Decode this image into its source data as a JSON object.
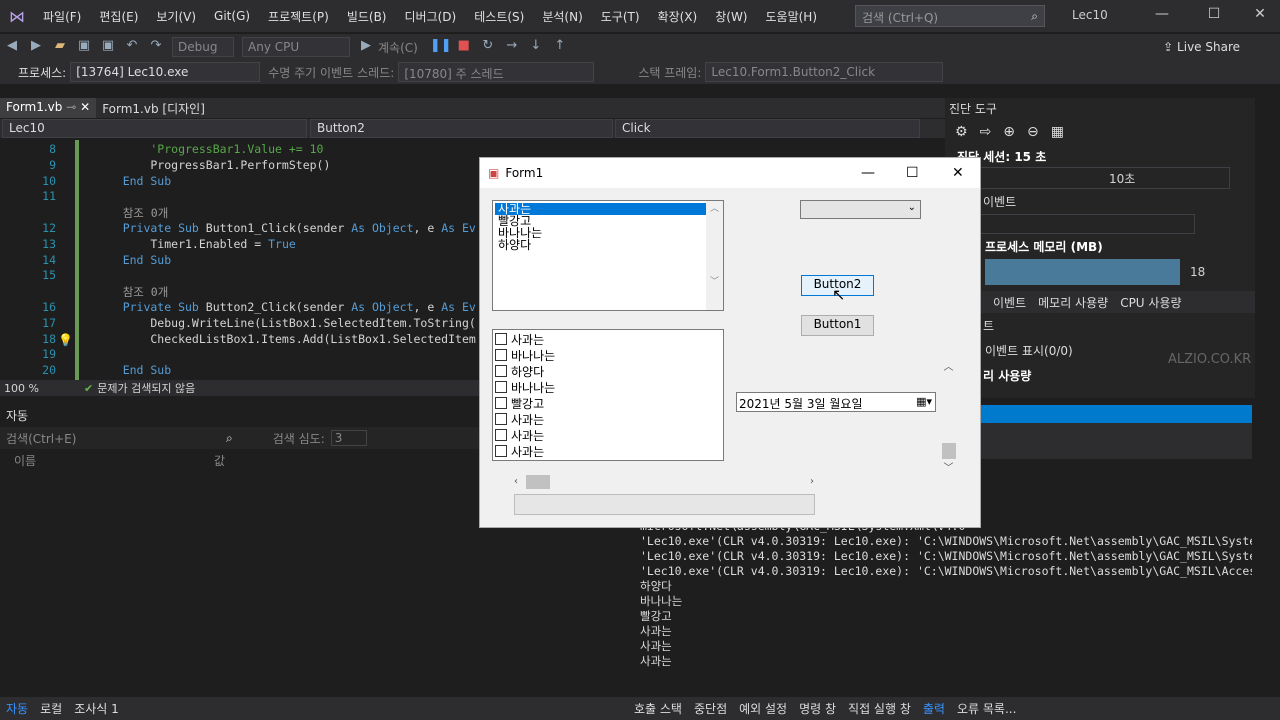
{
  "menu": [
    "파일(F)",
    "편집(E)",
    "보기(V)",
    "Git(G)",
    "프로젝트(P)",
    "빌드(B)",
    "디버그(D)",
    "테스트(S)",
    "분석(N)",
    "도구(T)",
    "확장(X)",
    "창(W)",
    "도움말(H)"
  ],
  "search_placeholder": "검색 (Ctrl+Q)",
  "project_title": "Lec10",
  "toolbar": {
    "config": "Debug",
    "platform": "Any CPU",
    "continue": "계속(C)",
    "live_share": "Live Share"
  },
  "toolbar2": {
    "process_label": "프로세스:",
    "process": "[13764] Lec10.exe",
    "lifecycle": "수명 주기 이벤트",
    "thread_label": "스레드:",
    "thread": "[10780] 주 스레드",
    "stack_label": "스택 프레임:",
    "stack": "Lec10.Form1.Button2_Click"
  },
  "tabs": [
    {
      "label": "Form1.vb"
    },
    {
      "label": "Form1.vb [디자인]"
    }
  ],
  "nav": {
    "project": "Lec10",
    "member": "Button2",
    "event": "Click"
  },
  "code_lines": [
    {
      "n": "8",
      "parts": [
        {
          "t": "        'ProgressBar1.Value += 10",
          "c": "cm"
        }
      ]
    },
    {
      "n": "9",
      "parts": [
        {
          "t": "        ProgressBar1.PerformStep()",
          "c": ""
        }
      ]
    },
    {
      "n": "10",
      "parts": [
        {
          "t": "    End Sub",
          "c": "kw"
        }
      ]
    },
    {
      "n": "11",
      "parts": [
        {
          "t": "",
          "c": ""
        }
      ]
    },
    {
      "n": "",
      "parts": [
        {
          "t": "    참조 0개",
          "c": "gr"
        }
      ]
    },
    {
      "n": "12",
      "parts": [
        {
          "t": "    Private Sub ",
          "c": "kw"
        },
        {
          "t": "Button1_Click(sender ",
          "c": ""
        },
        {
          "t": "As Object",
          "c": "kw"
        },
        {
          "t": ", e ",
          "c": ""
        },
        {
          "t": "As Ev",
          "c": "kw"
        }
      ]
    },
    {
      "n": "13",
      "parts": [
        {
          "t": "        Timer1.Enabled = ",
          "c": ""
        },
        {
          "t": "True",
          "c": "kw"
        }
      ]
    },
    {
      "n": "14",
      "parts": [
        {
          "t": "    End Sub",
          "c": "kw"
        }
      ]
    },
    {
      "n": "15",
      "parts": [
        {
          "t": "",
          "c": ""
        }
      ]
    },
    {
      "n": "",
      "parts": [
        {
          "t": "    참조 0개",
          "c": "gr"
        }
      ]
    },
    {
      "n": "16",
      "parts": [
        {
          "t": "    Private Sub ",
          "c": "kw"
        },
        {
          "t": "Button2_Click(sender ",
          "c": ""
        },
        {
          "t": "As Object",
          "c": "kw"
        },
        {
          "t": ", e ",
          "c": ""
        },
        {
          "t": "As Ev",
          "c": "kw"
        }
      ]
    },
    {
      "n": "17",
      "parts": [
        {
          "t": "        Debug.WriteLine(ListBox1.SelectedItem.ToString(",
          "c": ""
        }
      ]
    },
    {
      "n": "18",
      "parts": [
        {
          "t": "        CheckedListBox1.Items.Add(ListBox1.SelectedItem",
          "c": ""
        }
      ]
    },
    {
      "n": "19",
      "parts": [
        {
          "t": "",
          "c": ""
        }
      ]
    },
    {
      "n": "20",
      "parts": [
        {
          "t": "    End Sub",
          "c": "kw"
        }
      ]
    }
  ],
  "editor_status": {
    "zoom": "100 %",
    "issues": "문제가 검색되지 않음"
  },
  "autos": {
    "title": "자동",
    "search": "검색(Ctrl+E)",
    "depth_label": "검색 심도:",
    "depth": "3",
    "col_name": "이름",
    "col_value": "값"
  },
  "bottom_tabs_left": [
    "자동",
    "로컬",
    "조사식 1"
  ],
  "bottom_tabs_right": [
    "호출 스택",
    "중단점",
    "예외 설정",
    "명령 창",
    "직접 실행 창",
    "출력",
    "오류 목록..."
  ],
  "diag": {
    "title": "진단 도구",
    "session": "진단 세션: 15 초",
    "tick": "10초",
    "events": "이벤트",
    "memory": "프로세스 메모리 (MB)",
    "mem_value": "18",
    "tabs": [
      "이벤트",
      "메모리 사용량",
      "CPU 사용량"
    ],
    "ev_header": "트",
    "show_events": "이벤트 표시(0/0)",
    "mem_usage": "리 사용량"
  },
  "output_lines": [
    "microsoft.Net\\assembly\\GAC_MSIL\\System\\v4.0_4.0",
    "microsoft.Net\\assembly\\GAC_MSIL\\System.Drawing\\",
    "microsoft.Net\\assembly\\GAC_MSIL\\System.Configur",
    "microsoft.Net\\assembly\\GAC_MSIL\\System.Core\\v4.",
    "microsoft.Net\\assembly\\GAC_MSIL\\System.Xml\\v4.0",
    "'Lec10.exe'(CLR v4.0.30319: Lec10.exe): 'C:\\WINDOWS\\Microsoft.Net\\assembly\\GAC_MSIL\\System.Runtime.",
    "'Lec10.exe'(CLR v4.0.30319: Lec10.exe): 'C:\\WINDOWS\\Microsoft.Net\\assembly\\GAC_MSIL\\System.Windows.",
    "'Lec10.exe'(CLR v4.0.30319: Lec10.exe): 'C:\\WINDOWS\\Microsoft.Net\\assembly\\GAC_MSIL\\Accessibility\\v",
    "하양다",
    "바나나는",
    "빨강고",
    "사과는",
    "사과는",
    "사과는"
  ],
  "form1": {
    "title": "Form1",
    "listbox": [
      "사과는",
      "빨강고",
      "바나나는",
      "하양다"
    ],
    "checked_list": [
      "사과는",
      "바나나는",
      "하양다",
      "바나나는",
      "빨강고",
      "사과는",
      "사과는",
      "사과는"
    ],
    "button2": "Button2",
    "button1": "Button1",
    "date": "2021년   5월   3일 월요일"
  },
  "watermark": "ALZIO.CO.KR"
}
